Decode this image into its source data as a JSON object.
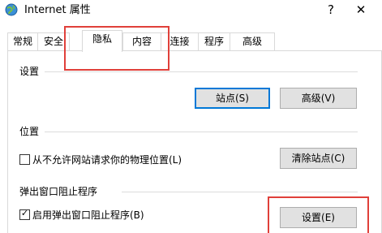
{
  "window": {
    "title": "Internet 属性",
    "help_glyph": "?",
    "close_glyph": "✕",
    "icon": "internet-options-globe-icon"
  },
  "tabs": [
    {
      "label": "常规",
      "selected": false
    },
    {
      "label": "安全",
      "selected": false
    },
    {
      "label": "隐私",
      "selected": true
    },
    {
      "label": "内容",
      "selected": false
    },
    {
      "label": "连接",
      "selected": false
    },
    {
      "label": "程序",
      "selected": false
    },
    {
      "label": "高级",
      "selected": false
    }
  ],
  "settings": {
    "heading": "设置",
    "sites_button": "站点(S)",
    "advanced_button": "高级(V)"
  },
  "location": {
    "heading": "位置",
    "never_allow_label": "从不允许网站请求你的物理位置(L)",
    "never_allow_checked": false,
    "clear_sites_button": "清除站点(C)"
  },
  "popup_blocker": {
    "heading": "弹出窗口阻止程序",
    "enable_label": "启用弹出窗口阻止程序(B)",
    "enable_checked": true,
    "settings_button": "设置(E)"
  },
  "checkmark_glyph": "✓",
  "colors": {
    "highlight": "#e0403a",
    "default_button_border": "#0078d7",
    "button_face": "#e1e1e1"
  }
}
